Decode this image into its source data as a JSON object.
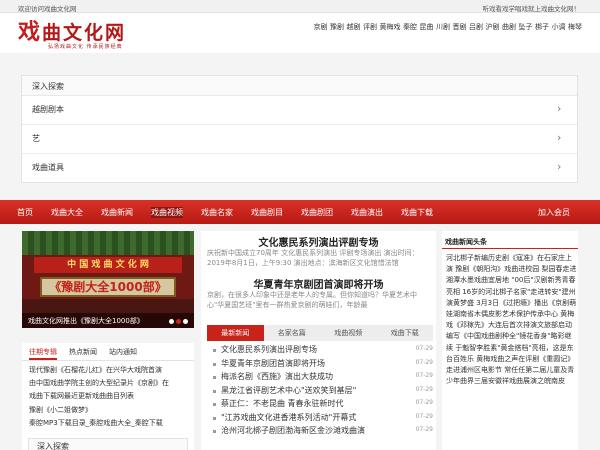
{
  "topbar": {
    "welcome": "欢迎访问戏曲文化网",
    "right_text": "听戏看戏学唱戏就上戏曲文化网！"
  },
  "logo": {
    "mark": "戏",
    "title": "曲文化网",
    "slogan": "弘扬戏曲文化 传承民族经典"
  },
  "top_nav": [
    "京剧",
    "豫剧",
    "越剧",
    "评剧",
    "黄梅戏",
    "秦腔",
    "昆曲",
    "川剧",
    "晋剧",
    "吕剧",
    "沪剧",
    "曲剧",
    "坠子",
    "梆子",
    "小调",
    "梅琴"
  ],
  "explore": {
    "header": "深入探索",
    "items": [
      "越剧剧本",
      "艺",
      "戏曲道具"
    ]
  },
  "main_nav": {
    "items": [
      "首页",
      "戏曲大全",
      "戏曲新闻",
      "戏曲视频",
      "戏曲名家",
      "戏曲剧目",
      "戏曲剧团",
      "戏曲演出",
      "戏曲下载"
    ],
    "active_index": 3,
    "member": "加入会员"
  },
  "banner": {
    "sign1": "中 国 戏 曲 文 化 网",
    "sign2": "《豫剧大全1000部》",
    "caption": "戏曲文化网推出《豫剧大全1000部》",
    "active_dot": 1,
    "dots": 3
  },
  "left_tabs": {
    "tabs": [
      "往期专辑",
      "热点新闻",
      "站内通知"
    ],
    "active_index": 0,
    "items": [
      "现代豫剧《石榴花儿红》在兴华大戏院首演",
      "由中国戏曲学院主创的大型纪录片《京剧》在",
      "戏曲下载网最近更新戏曲曲目列表",
      "豫剧《小二姐做梦》",
      "秦腔MP3下载目录_秦腔戏曲大全_秦腔下载"
    ]
  },
  "side_explore_header": "深入探索",
  "featured": [
    {
      "title": "文化惠民系列演出评剧专场",
      "desc": "庆祝新中国成立70周年 文化惠民系列演出 评剧专场演出 演出时间：2019年8月1日，上午9:30 演出地点：滨海新区文化馆惜法馆"
    },
    {
      "title": "华夏青年京剧团首演即将开场",
      "desc": "京剧，在很多人印象中还是老年人的专属。但你知道吗？华夏艺术中心\"华夏国艺班\"里有一群热爱京剧的萌娃们，年龄最"
    }
  ],
  "center_tabs": {
    "tabs": [
      "最新新闻",
      "名家名篇",
      "戏曲视频",
      "戏曲下载"
    ],
    "active_index": 0
  },
  "news_list": [
    {
      "title": "文化惠民系列演出评剧专场",
      "date": "07-29"
    },
    {
      "title": "华夏青年京剧团首演即将开场",
      "date": "07-29"
    },
    {
      "title": "梅派名剧《西施》演出大获成功",
      "date": "07-29"
    },
    {
      "title": "黑龙江省评剧艺术中心\"送欢笑到基层\"",
      "date": "07-29"
    },
    {
      "title": "蔡正仁：不老昆曲 青春永驻新时代",
      "date": "07-29"
    },
    {
      "title": "\"江苏戏曲文化进香港系列活动\"开幕式",
      "date": "07-29"
    },
    {
      "title": "沧州河北梆子剧团渤海新区金沙滩戏曲演",
      "date": "07-29"
    }
  ],
  "right": {
    "header": "戏曲新闻头条",
    "body": "河北梆子新编历史剧《寇准》在石家庄上演 豫剧《朝阳沟》戏曲进校园 梨园春走进湘潭水墨戏曲宜居地 \"00后\"汉剧新秀青春亮相 16岁的河北梆子名家\"走进转安\"建州演黄梦盛 3月3日《过把瘾》播出《京剧萌娃湖南省木偶皮影艺术保护传承中心 黄梅戏《邓稼先》大连后首次排演文旅部启动编写《中国戏曲剧种全\"镜花香身\"略彩继续 于魁智李胜素\"黄金搭档\"亮相，这是东台百姓乐 黄梅戏曲之声在评剧《重圆记》走进浦州区电影节 常任任第二届儿童及青少年曲界三届安徽祥戏曲展演之皖南皮"
  }
}
